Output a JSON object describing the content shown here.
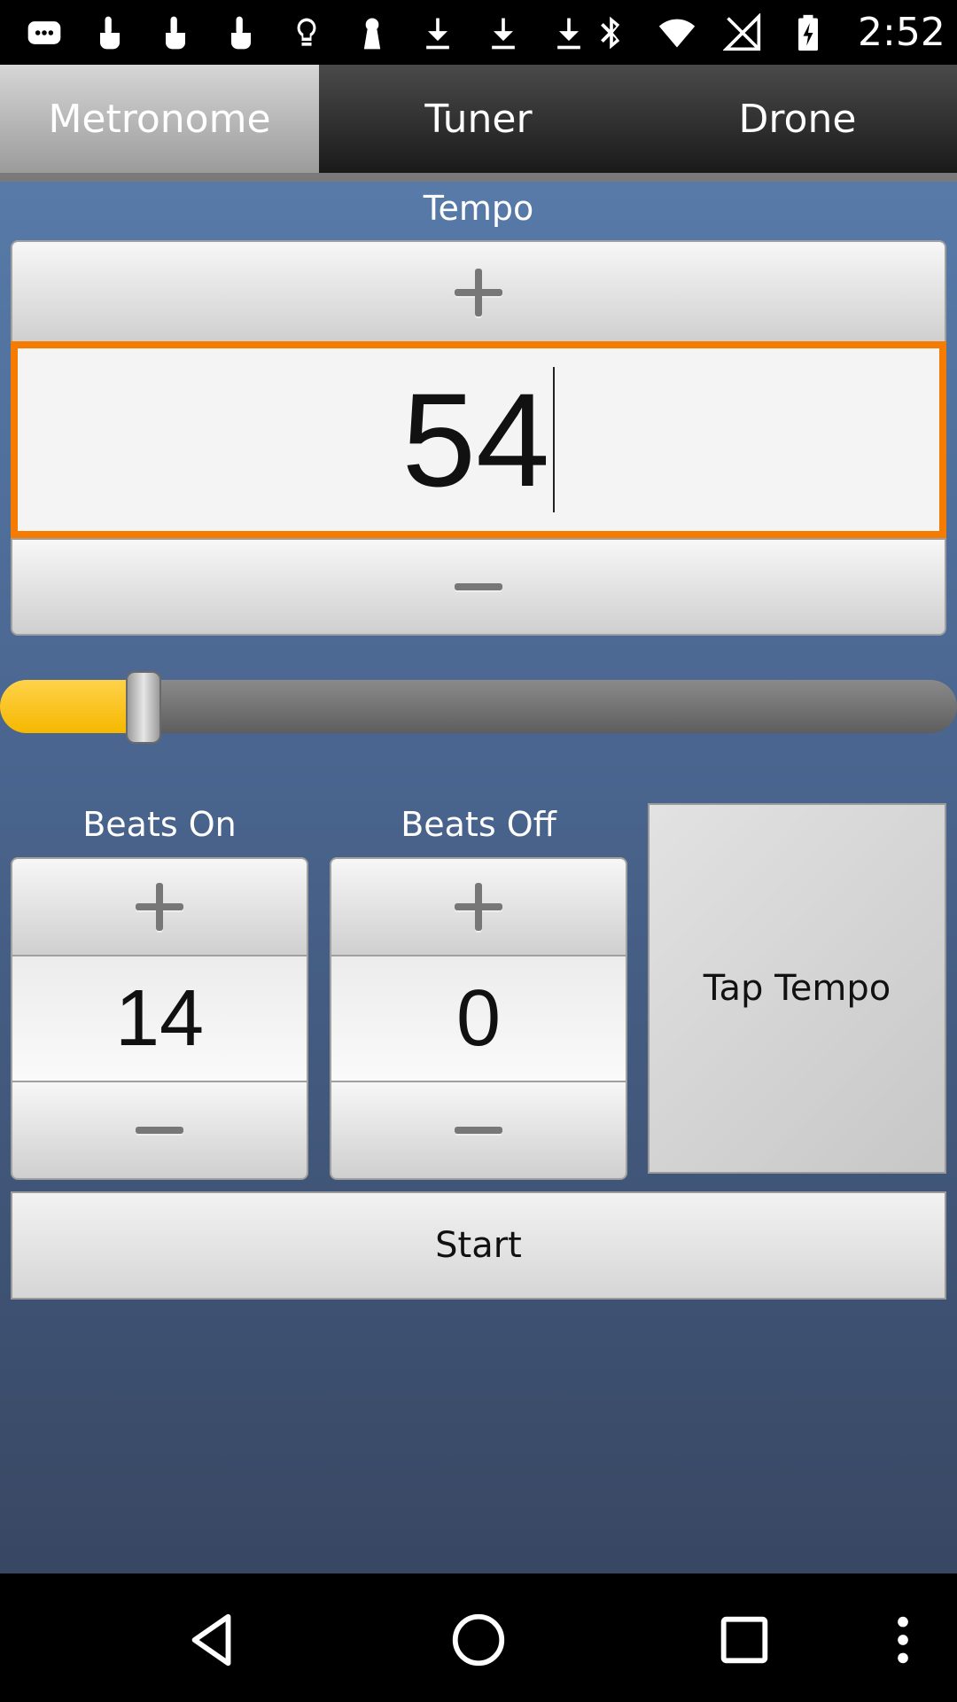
{
  "status_bar": {
    "time": "2:52",
    "left_icons": [
      "message-icon",
      "touch-icon",
      "touch-icon",
      "touch-icon",
      "bulb-icon",
      "keyhole-icon",
      "download-icon",
      "download-icon",
      "download-icon"
    ],
    "right_icons": [
      "bluetooth-icon",
      "wifi-icon",
      "no-signal-icon",
      "battery-charging-icon"
    ]
  },
  "tabs": [
    {
      "label": "Metronome",
      "active": true
    },
    {
      "label": "Tuner",
      "active": false
    },
    {
      "label": "Drone",
      "active": false
    }
  ],
  "tempo": {
    "label": "Tempo",
    "value": "54",
    "slider_fraction": 0.15
  },
  "beats_on": {
    "label": "Beats On",
    "value": "14"
  },
  "beats_off": {
    "label": "Beats Off",
    "value": "0"
  },
  "tap_tempo_label": "Tap Tempo",
  "start_label": "Start",
  "colors": {
    "accent_orange": "#f57c00",
    "slider_yellow": "#f5b800",
    "background_blue": "#4a6690"
  },
  "nav_bar": {
    "icons": [
      "back-icon",
      "home-icon",
      "recents-icon",
      "more-options-icon"
    ]
  }
}
